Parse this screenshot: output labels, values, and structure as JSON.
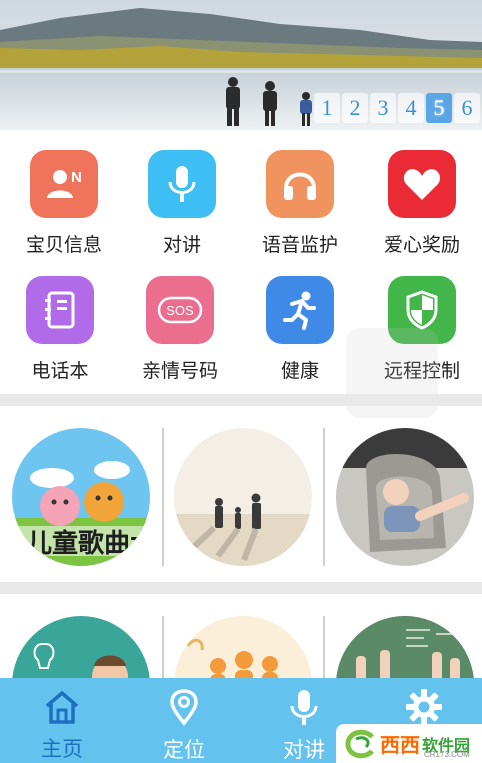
{
  "banner": {
    "pages": [
      "1",
      "2",
      "3",
      "4",
      "5",
      "6"
    ],
    "active_page": "5"
  },
  "grid": [
    {
      "label": "宝贝信息",
      "icon": "child-info-icon",
      "color": "#f0745b"
    },
    {
      "label": "对讲",
      "icon": "microphone-icon",
      "color": "#3dbff3"
    },
    {
      "label": "语音监护",
      "icon": "headphones-icon",
      "color": "#f0935f"
    },
    {
      "label": "爱心奖励",
      "icon": "heart-icon",
      "color": "#ea2a35"
    },
    {
      "label": "电话本",
      "icon": "phonebook-icon",
      "color": "#b16be8"
    },
    {
      "label": "亲情号码",
      "icon": "sos-icon",
      "color": "#ec6e8f",
      "text": "SOS"
    },
    {
      "label": "健康",
      "icon": "running-icon",
      "color": "#3f8ae6"
    },
    {
      "label": "远程控制",
      "icon": "shield-icon",
      "color": "#43b64a"
    }
  ],
  "feed": {
    "row1": [
      {
        "name": "children-songs-thumbnail",
        "text": "儿童歌曲大"
      },
      {
        "name": "family-beach-thumbnail"
      },
      {
        "name": "child-car-seat-thumbnail"
      }
    ],
    "row2": [
      {
        "name": "boy-idea-thumbnail"
      },
      {
        "name": "family-silhouette-thumbnail"
      },
      {
        "name": "classroom-hands-thumbnail"
      }
    ]
  },
  "bottom_nav": [
    {
      "label": "主页",
      "icon": "home-icon",
      "active": true
    },
    {
      "label": "定位",
      "icon": "location-pin-icon",
      "active": false
    },
    {
      "label": "对讲",
      "icon": "microphone-icon",
      "active": false
    },
    {
      "label": "",
      "icon": "gear-icon",
      "active": false
    }
  ],
  "watermark": {
    "main": "西西",
    "sub": "软件园",
    "domain": "CR173.COM"
  },
  "colors": {
    "nav_bg": "#63c3ee",
    "nav_active": "#1f6fc0",
    "divider": "#e8e8e8"
  }
}
